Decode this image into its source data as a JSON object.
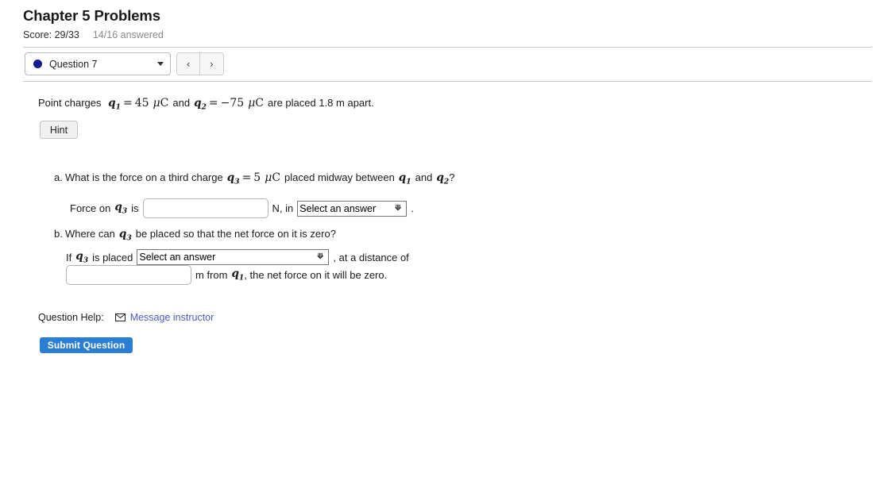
{
  "header": {
    "title": "Chapter 5 Problems",
    "score_label": "Score: 29/33",
    "answered_label": "14/16 answered"
  },
  "toolbar": {
    "question_selector_label": "Question 7",
    "question_dot_color": "#151b8d",
    "prev_label": "‹",
    "next_label": "›"
  },
  "question": {
    "prompt": {
      "lead": "Point charges",
      "q1_sym": "q",
      "q1_sub": "1",
      "eq1": "=",
      "q1_val": "45",
      "mu": "μ",
      "unit_C": "C",
      "and": "and",
      "q2_sym": "q",
      "q2_sub": "2",
      "eq2": "=",
      "q2_val": "−75",
      "tail": "are placed 1.8 m apart."
    },
    "hint_label": "Hint",
    "parts": [
      {
        "marker": "a.",
        "text_1": "What is the force on a third charge",
        "q3_sym": "q",
        "q3_sub": "3",
        "eq": "=",
        "q3_val": "5",
        "mu": "μ",
        "unit_C": "C",
        "text_2": "placed midway between",
        "qa_sym": "q",
        "qa_sub": "1",
        "and": "and",
        "qb_sym": "q",
        "qb_sub": "2",
        "qmark": "?",
        "answer_prefix": "Force on",
        "answer_q_sym": "q",
        "answer_q_sub": "3",
        "answer_is": "is",
        "force_value": "",
        "force_placeholder": "",
        "unit_mid": "N, in",
        "unit_select_value": "Select an answer",
        "period": "."
      },
      {
        "marker": "b.",
        "text_1": "Where can",
        "qb3_sym": "q",
        "qb3_sub": "3",
        "text_2": "be placed so that the net force on it is zero?",
        "line1_prefix": "If",
        "line1_q_sym": "q",
        "line1_q_sub": "3",
        "line1_is_placed": "is placed",
        "place_select_value": "Select an answer",
        "line1_suffix": ", at a distance of",
        "distance_value": "",
        "distance_placeholder": "",
        "line2_m_from": "m from",
        "line2_q_sym": "q",
        "line2_q_sub": "1",
        "line2_suffix": ", the net force on it will be zero."
      }
    ]
  },
  "footer": {
    "question_help_label": "Question Help:",
    "message_instructor_label": "Message instructor",
    "message_link_color": "#4f58c4",
    "submit_label": "Submit Question",
    "submit_color": "#2a7fd4"
  }
}
